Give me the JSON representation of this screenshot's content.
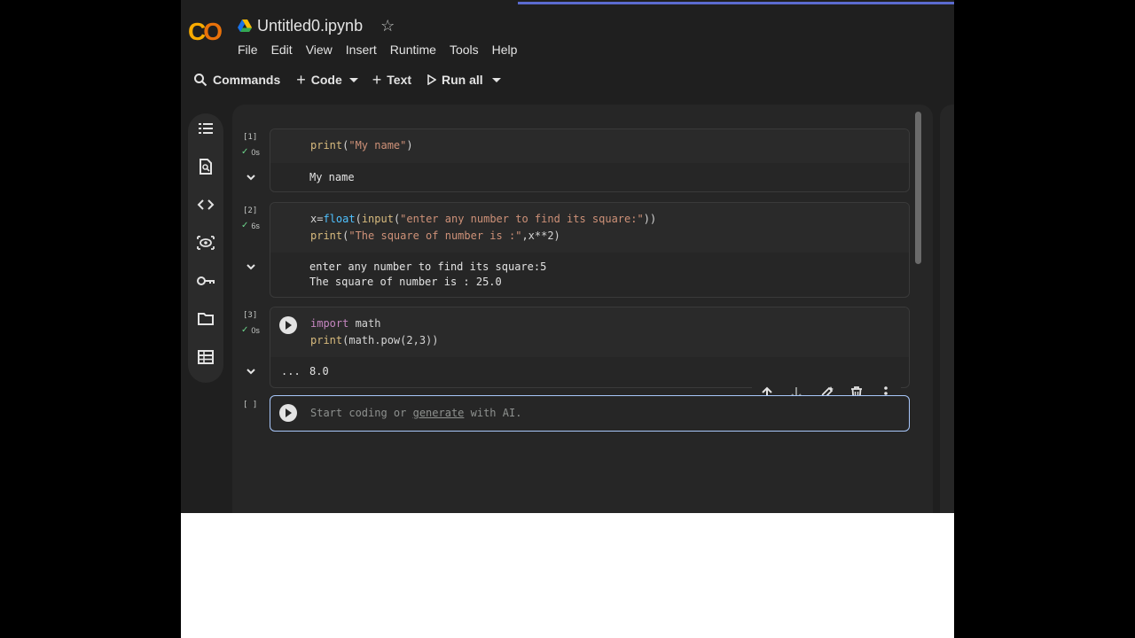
{
  "window": {
    "file_title": "Untitled0.ipynb",
    "logo_text": "CO"
  },
  "menu": [
    "File",
    "Edit",
    "View",
    "Insert",
    "Runtime",
    "Tools",
    "Help"
  ],
  "toolbar": {
    "commands_label": "Commands",
    "code_label": "Code",
    "text_label": "Text",
    "run_all_label": "Run all"
  },
  "sidebar_icons": [
    "table-of-contents-icon",
    "find-icon",
    "code-snippets-icon",
    "variables-icon",
    "secrets-key-icon",
    "files-folder-icon",
    "data-table-icon"
  ],
  "cells": [
    {
      "exec_count": "[1]",
      "duration": "0s",
      "code_lines": [
        "print(\"My name\")"
      ],
      "output_lines": [
        "My name"
      ]
    },
    {
      "exec_count": "[2]",
      "duration": "6s",
      "code_lines": [
        "x=float(input(\"enter any number to find its square:\"))",
        "print(\"The square of number is :\",x**2)"
      ],
      "output_lines": [
        "enter any number to find its square:5",
        "The square of number is : 25.0"
      ]
    },
    {
      "exec_count": "[3]",
      "duration": "0s",
      "code_lines": [
        "import math",
        "print(math.pow(2,3))"
      ],
      "output_prefix": "...",
      "output_lines": [
        "8.0"
      ]
    }
  ],
  "active_cell": {
    "exec_count": "[ ]",
    "placeholder_before": "Start coding or ",
    "placeholder_link": "generate",
    "placeholder_after": " with AI."
  },
  "colors": {
    "background": "#1f1f1f",
    "logo_orange": "#f9ab00",
    "active_border": "#a8c7fa",
    "success_check": "#6dd58c"
  }
}
